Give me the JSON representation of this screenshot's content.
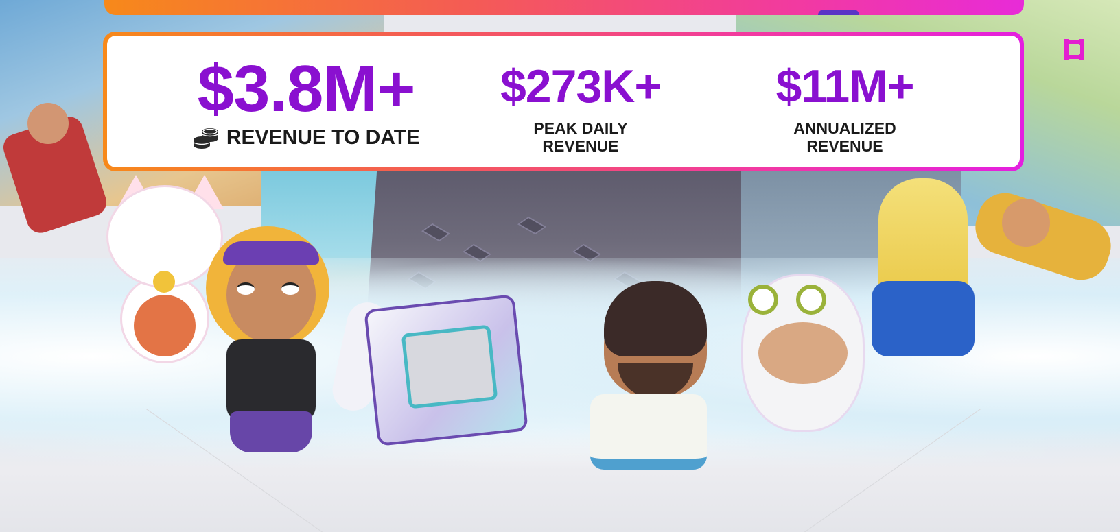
{
  "stats": {
    "revenue_to_date": {
      "value": "$3.8M+",
      "label": "REVENUE TO DATE"
    },
    "peak_daily": {
      "value": "$273K+",
      "label_line1": "PEAK DAILY",
      "label_line2": "REVENUE"
    },
    "annualized": {
      "value": "$11M+",
      "label_line1": "ANNUALIZED",
      "label_line2": "REVENUE"
    }
  },
  "icons": {
    "revenue_icon": "coins-icon",
    "marker_icon": "selection-square-icon"
  },
  "colors": {
    "accent_purple": "#8a10d0",
    "gradient_start": "#f7891a",
    "gradient_mid": "#f23aa0",
    "gradient_end": "#e41fe0",
    "marker": "#e31fd0"
  }
}
